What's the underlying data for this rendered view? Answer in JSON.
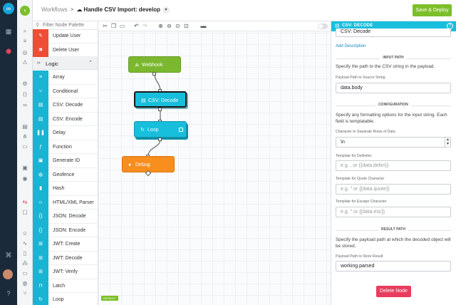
{
  "header": {
    "breadcrumb_root": "Workflows",
    "breadcrumb_separator": ">",
    "workflow_name": "Handle CSV Import: develop",
    "save_button": "Save & Deploy"
  },
  "palette": {
    "filter_placeholder": "Filter Node Palette",
    "top_items": [
      {
        "label": "Update User",
        "icon": "user-edit-icon"
      },
      {
        "label": "Delete User",
        "icon": "user-delete-icon"
      }
    ],
    "category": "Logic",
    "items": [
      {
        "label": "Array",
        "icon": "list-icon"
      },
      {
        "label": "Conditional",
        "icon": "branch-icon"
      },
      {
        "label": "CSV: Decode",
        "icon": "document-icon"
      },
      {
        "label": "CSV: Encode",
        "icon": "document-icon"
      },
      {
        "label": "Delay",
        "icon": "pause-icon"
      },
      {
        "label": "Function",
        "icon": "function-icon"
      },
      {
        "label": "Generate ID",
        "icon": "id-icon"
      },
      {
        "label": "Geofence",
        "icon": "globe-icon"
      },
      {
        "label": "Hash",
        "icon": "lock-icon"
      },
      {
        "label": "HTML/XML Parser",
        "icon": "code-icon"
      },
      {
        "label": "JSON: Decode",
        "icon": "braces-icon"
      },
      {
        "label": "JSON: Encode",
        "icon": "braces-icon"
      },
      {
        "label": "JWT: Create",
        "icon": "token-icon"
      },
      {
        "label": "JWT: Decode",
        "icon": "token-icon"
      },
      {
        "label": "JWT: Verify",
        "icon": "token-icon"
      },
      {
        "label": "Latch",
        "icon": "latch-icon"
      },
      {
        "label": "Loop",
        "icon": "loop-icon"
      }
    ]
  },
  "canvas": {
    "nodes": {
      "webhook": "Webhook",
      "csv_decode": "CSV: Decode",
      "loop": "Loop",
      "debug": "Debug"
    },
    "tag": "DEFAULT"
  },
  "panel": {
    "title": "CSV: DECODE",
    "name_value": "CSV: Decode",
    "add_description": "Add Description",
    "input_section": "INPUT PATH",
    "input_help": "Specify the path to the CSV string in the payload.",
    "source_label": "Payload Path to Source String",
    "source_value": "data.body",
    "config_section": "CONFIGURATION",
    "config_help": "Specify any formatting options for the input string. Each field is templatable.",
    "rows_label": "Character to Separate Rows of Data",
    "rows_value": "\\n",
    "delimiter_label": "Template for Delimiter",
    "delimiter_placeholder": "e.g. , or {{data.delim}}",
    "quote_label": "Template for Quote Character",
    "quote_placeholder": "e.g. \" or {{data.quote}}",
    "escape_label": "Template for Escape Character",
    "escape_placeholder": "e.g. \" or {{data.esc}}",
    "result_section": "RESULT PATH",
    "result_help": "Specify the payload path at which the decoded object will be stored.",
    "result_label": "Payload Path to Store Result",
    "result_value": "working.parsed",
    "delete_button": "Delete Node"
  }
}
